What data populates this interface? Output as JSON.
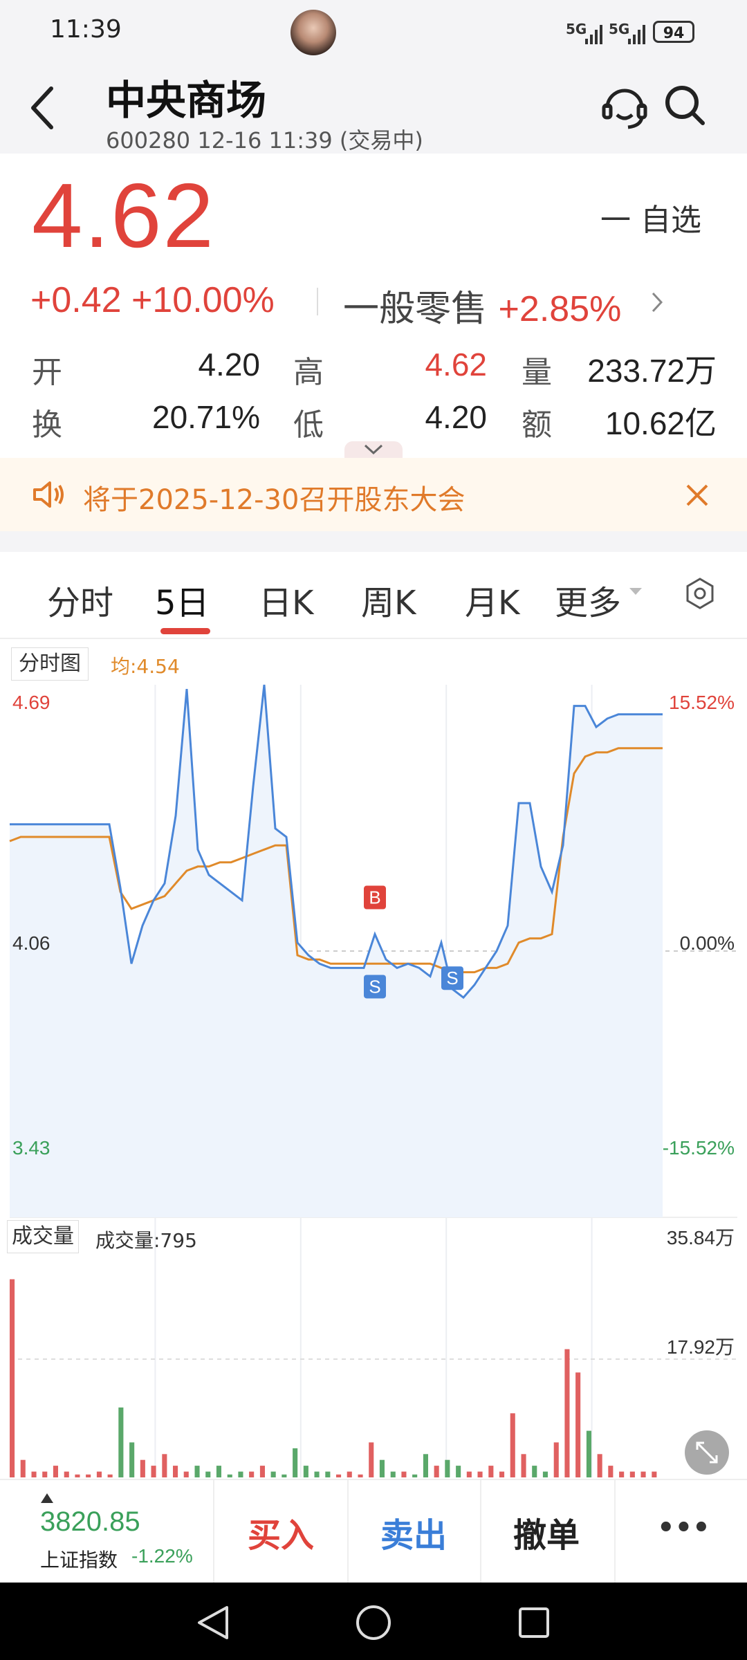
{
  "status_bar": {
    "time": "11:39",
    "signal1": "5G",
    "signal2": "5G",
    "battery": "94"
  },
  "header": {
    "title": "中央商场",
    "subtitle": "600280 12-16 11:39 (交易中)"
  },
  "quote": {
    "price": "4.62",
    "watch_label": "一 自选",
    "change": "+0.42 +10.00%",
    "sector_name": "一般零售",
    "sector_change": "+2.85%",
    "stats": [
      {
        "label": "开",
        "value": "4.20"
      },
      {
        "label": "高",
        "value": "4.62"
      },
      {
        "label": "量",
        "value": "233.72万"
      },
      {
        "label": "换",
        "value": "20.71%"
      },
      {
        "label": "低",
        "value": "4.20"
      },
      {
        "label": "额",
        "value": "10.62亿"
      }
    ]
  },
  "notice": {
    "text": "将于2025-12-30召开股东大会"
  },
  "tabs": [
    {
      "label": "分时"
    },
    {
      "label": "5日"
    },
    {
      "label": "日K"
    },
    {
      "label": "周K"
    },
    {
      "label": "月K"
    },
    {
      "label": "更多"
    }
  ],
  "chart_legend": {
    "name": "分时图",
    "avg": "均:4.54"
  },
  "volume_legend": {
    "name": "成交量",
    "value": "成交量:795"
  },
  "chart_data": {
    "type": "line",
    "title": "",
    "price_axis": {
      "top": "4.69",
      "mid": "4.06",
      "bottom": "3.43"
    },
    "pct_axis": {
      "top": "15.52%",
      "mid": "0.00%",
      "bottom": "-15.52%"
    },
    "ylim": [
      3.43,
      4.69
    ],
    "days": 5,
    "series": [
      {
        "name": "price",
        "color": "#4a86d8",
        "values": [
          4.36,
          4.36,
          4.36,
          4.36,
          4.36,
          4.36,
          4.36,
          4.36,
          4.36,
          4.36,
          4.21,
          4.03,
          4.12,
          4.18,
          4.22,
          4.38,
          4.68,
          4.3,
          4.24,
          4.22,
          4.2,
          4.18,
          4.45,
          4.69,
          4.35,
          4.33,
          4.08,
          4.05,
          4.03,
          4.02,
          4.02,
          4.02,
          4.02,
          4.1,
          4.04,
          4.02,
          4.03,
          4.02,
          4.0,
          4.08,
          3.97,
          3.95,
          3.98,
          4.02,
          4.06,
          4.12,
          4.41,
          4.41,
          4.26,
          4.2,
          4.31,
          4.64,
          4.64,
          4.59,
          4.61,
          4.62,
          4.62,
          4.62,
          4.62,
          4.62
        ]
      },
      {
        "name": "avg",
        "color": "#e08a2a",
        "values": [
          4.32,
          4.33,
          4.33,
          4.33,
          4.33,
          4.33,
          4.33,
          4.33,
          4.33,
          4.33,
          4.2,
          4.16,
          4.17,
          4.18,
          4.19,
          4.22,
          4.25,
          4.26,
          4.26,
          4.27,
          4.27,
          4.28,
          4.29,
          4.3,
          4.31,
          4.31,
          4.05,
          4.04,
          4.04,
          4.03,
          4.03,
          4.03,
          4.03,
          4.03,
          4.03,
          4.03,
          4.03,
          4.03,
          4.03,
          4.02,
          4.02,
          4.01,
          4.01,
          4.02,
          4.02,
          4.03,
          4.08,
          4.09,
          4.09,
          4.1,
          4.33,
          4.48,
          4.52,
          4.53,
          4.53,
          4.54,
          4.54,
          4.54,
          4.54,
          4.54
        ]
      }
    ],
    "markers": [
      {
        "label": "B",
        "x_index": 33,
        "price": 4.1,
        "color": "#e0433b"
      },
      {
        "label": "S",
        "x_index": 33,
        "price": 4.02,
        "color": "#4a86d8"
      },
      {
        "label": "S",
        "x_index": 40,
        "price": 4.04,
        "color": "#4a86d8"
      }
    ],
    "volume": {
      "axis": {
        "top": "35.84万",
        "mid": "17.92万"
      },
      "max": 35.84,
      "bars": [
        34,
        3,
        1,
        1,
        2,
        1,
        0.5,
        0.5,
        1,
        0.5,
        12,
        6,
        3,
        2,
        4,
        2,
        1,
        2,
        1,
        2,
        0.5,
        1,
        1,
        2,
        1,
        0.5,
        5,
        2,
        1,
        1,
        0.5,
        1,
        0.5,
        6,
        3,
        1,
        1,
        0.5,
        4,
        2,
        3,
        2,
        1,
        1,
        2,
        1,
        11,
        4,
        2,
        1,
        6,
        22,
        18,
        8,
        4,
        2,
        1,
        1,
        1,
        1
      ]
    }
  },
  "bottom_bar": {
    "index_value": "3820.85",
    "index_name": "上证指数",
    "index_change": "-1.22%",
    "buy": "买入",
    "sell": "卖出",
    "cancel": "撤单",
    "more": "•••"
  }
}
